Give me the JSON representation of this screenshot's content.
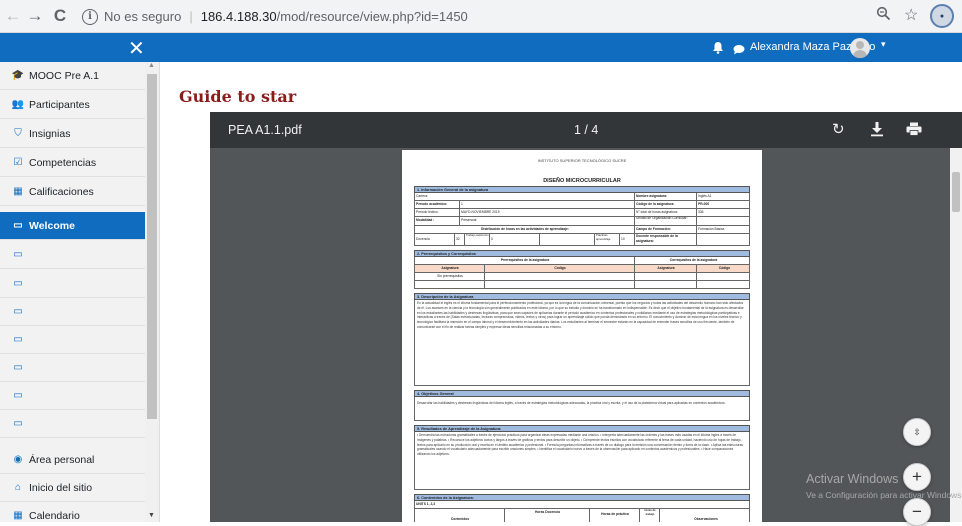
{
  "browser": {
    "security_label": "No es seguro",
    "url_host": "186.4.188.30",
    "url_path": "/mod/resource/view.php?id=1450",
    "back_glyph": "←",
    "forward_glyph": "→",
    "reload_glyph": "C",
    "icons": [
      "info-icon",
      "zoom-icon",
      "star-icon",
      "profile-icon"
    ]
  },
  "header": {
    "close_glyph": "✕",
    "user_name": "Alexandra Maza Pazmino",
    "caret_glyph": "▾",
    "color": "#0f6cbf"
  },
  "sidebar": {
    "items": [
      {
        "label": "MOOC Pre A.1",
        "icon": "graduation-cap-icon",
        "glyph": "🎓"
      },
      {
        "label": "Participantes",
        "icon": "users-icon",
        "glyph": "👥"
      },
      {
        "label": "Insignias",
        "icon": "shield-icon",
        "glyph": "⛉"
      },
      {
        "label": "Competencias",
        "icon": "checkbox-icon",
        "glyph": "☑"
      },
      {
        "label": "Calificaciones",
        "icon": "table-icon",
        "glyph": "▦"
      },
      {
        "label": "Welcome",
        "icon": "folder-icon",
        "glyph": "▭",
        "active": true
      },
      {
        "label": "",
        "icon": "folder-icon",
        "glyph": "▭"
      },
      {
        "label": "",
        "icon": "folder-icon",
        "glyph": "▭"
      },
      {
        "label": "",
        "icon": "folder-icon",
        "glyph": "▭"
      },
      {
        "label": "",
        "icon": "folder-icon",
        "glyph": "▭"
      },
      {
        "label": "",
        "icon": "folder-icon",
        "glyph": "▭"
      },
      {
        "label": "",
        "icon": "folder-icon",
        "glyph": "▭"
      },
      {
        "label": "",
        "icon": "folder-icon",
        "glyph": "▭"
      },
      {
        "label": "Área personal",
        "icon": "dashboard-icon",
        "glyph": "◉"
      },
      {
        "label": "Inicio del sitio",
        "icon": "home-icon",
        "glyph": "⌂"
      },
      {
        "label": "Calendario",
        "icon": "calendar-icon",
        "glyph": "▦"
      }
    ]
  },
  "main": {
    "heading": "Guide to star"
  },
  "viewer": {
    "file_name": "PEA A1.1.pdf",
    "page_indicator": "1 / 4",
    "rotate_glyph": "↻"
  },
  "document": {
    "institution": "INSTITUTO SUPERIOR TECNOLÓGICO SUCRE",
    "title": "DISEÑO MICROCURRICULAR",
    "sec1": "1. Información General de la asignatura",
    "r_carrera": "Carrera:",
    "r_nombre": "Nombre asignatura:",
    "v_nombre": "Inglés A1",
    "r_periodo": "Período académico:",
    "v_periodo": "1",
    "r_codigo": "Código de la asignatura:",
    "v_codigo": "PR-000",
    "r_lectivo": "Periodo lectivo:",
    "v_lectivo": "MAYO-NOVIEMBRE 2019",
    "r_horas": "N° total de horas asignatura:",
    "v_horas": "336",
    "r_modalidad": "Modalidad :",
    "v_modalidad": "Presencial",
    "r_unidad": "Unidad de Organización Curricular:",
    "r_dist": "Distribución de horas en las actividades de aprendizaje:",
    "r_campo": "Campo de Formación:",
    "v_campo": "Formación Básica",
    "r_docencia": "Docencia",
    "v_docencia": "32",
    "r_trabajo": "Trabajo autónomo",
    "v_trabajo": "0",
    "r_practicas": "Prácticas aprendizaje",
    "v_practicas": "10",
    "r_docente": "Docente responsable de la asignatura:",
    "sec2": "2. Prerrequisitos y Correquisitos",
    "prer": "Prerrequisitos de la asignatura",
    "corr": "Correquisitos de la asignatura",
    "asig": "Asignatura",
    "cod": "Código",
    "sin_pre": "Sin prerrequisitos",
    "sec3": "3. Descripción de la Asignatura",
    "desc": "En la actualidad el inglés es el idioma fundamental para el perfeccionamiento profesional, ya que es la lengua de la comunicación universal, puesto que los negocios y todas las actividades del desarrollo humano han sido afectados de él. Los avances en la ciencia y la tecnología son generalmente publicados en este idioma, por lo que su estudio y dominio se ha transformado en indispensable. Es decir que el objetivo fundamental de la asignatura es desarrollar en los estudiantes las habilidades y destrezas lingüísticas, para que sean capaces de aplicarlas durante el período académico en contextos profesionales y cotidianos mediante el uso de estrategias metodológicas participativas e interactivas a través de (Salas estructuradas, lecturas comprensivas, videos, textos y otros) para lograr un aprendizaje sólido que pueda demostrarlo en su entorno. El conocimiento y dominio de esta lengua en los niveles técnico y tecnológico facilitará la inserción en el campo laboral y el desenvolvimiento en las actividades diarias. Los estudiantes al terminar el semestre estarán en la capacidad de entender frases sencillas de uso frecuente, también de comunicarse con el fin de realizar tareas simples y expresar ideas sencillas relacionadas a su entorno.",
    "sec4": "4. Objetivos General",
    "obj": "Desarrollar las habilidades y destrezas lingüísticas del idioma inglés, a través de estrategias metodológicas adecuadas, la práctica oral y escrita, y el uso de la plataforma virtual para aplicarlas en contextos académicos.",
    "sec5": "5. Resultados de Aprendizaje de la Asignatura:",
    "res": "• Demuestra las estructuras gramaticales a través de ejercicios prácticos para organizar ideas expresadas mediante una oración. • Interpreta adecuadamente las órdenes y las frases más usadas en el idioma inglés a través de imágenes y palabras. • Reconoce los adjetivos cortos y largos a través de gráficos y textos para describir un objeto. • Comprende textos escritos con vocabulario referente al tema de cada unidad, haciendo uso de hojas de trabajo, textos para aplicarlo en su producción oral y escrita en el ámbito académico y profesional. • Formula preguntas informativas a través de un diálogo para la emisión una conversación dentro y fuera de la clase. • Aplica las estructuras gramaticales usando el vocabulario adecuadamente para escribir oraciones simples. • Identifica el vocabulario nuevo a través de la observación para aplicarlo en contextos académicos y profesionales. • Hace comparaciones utilizando los adjetivos.",
    "sec6": "6. Contenidos de la Asignatura:",
    "unit": "UNITS 1, 2,3",
    "col_contenido": "Contenidos",
    "col_horas": "Horas Docencia",
    "col_practica": "Horas de práctica",
    "col_trabajo": "Horas de trabajo",
    "col_obs": "Observaciones"
  },
  "overlay": {
    "fit_glyph": "⇳",
    "zoom_in_glyph": "+",
    "zoom_out_glyph": "−",
    "activate_title": "Activar Windows",
    "activate_sub": "Ve a Configuración para activar Windows."
  }
}
